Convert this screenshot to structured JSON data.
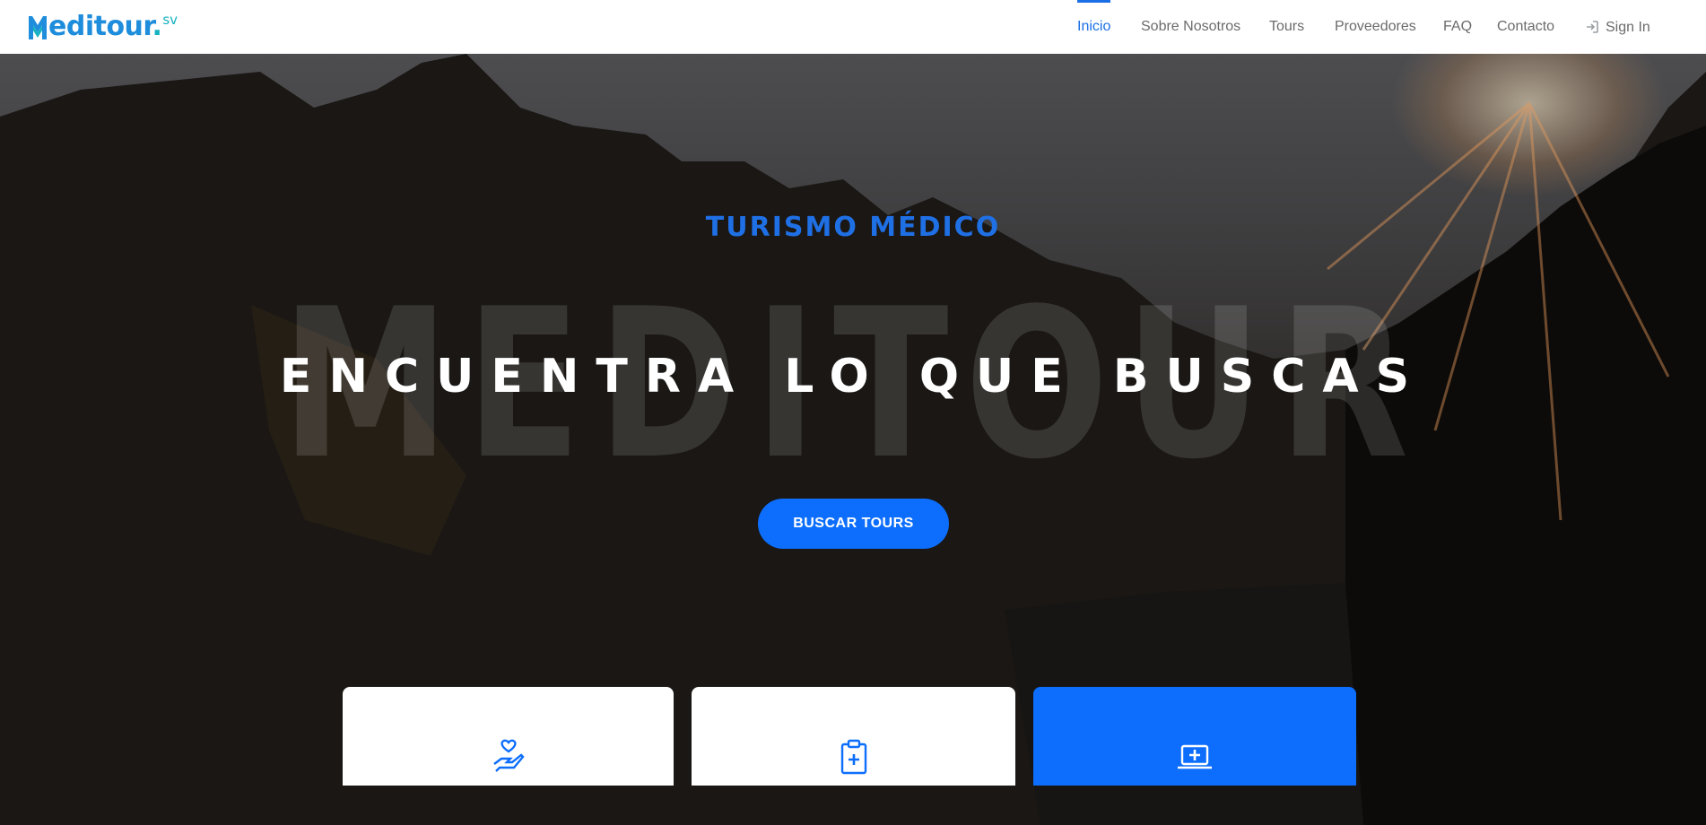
{
  "brand": {
    "name_part1": "M",
    "name_part2": "editour",
    "dot": ".",
    "suffix": "sv"
  },
  "nav": {
    "items": [
      {
        "label": "Inicio",
        "active": true
      },
      {
        "label": "Sobre Nosotros",
        "active": false
      },
      {
        "label": "Tours",
        "active": false
      },
      {
        "label": "Proveedores",
        "active": false
      },
      {
        "label": "FAQ",
        "active": false
      },
      {
        "label": "Contacto",
        "active": false
      }
    ],
    "signin_label": "Sign In",
    "signin_icon": "sign-in-icon"
  },
  "hero": {
    "eyebrow": "TURISMO MÉDICO",
    "watermark": "MEDITOUR",
    "headline": "ENCUENTRA LO QUE BUSCAS",
    "cta_label": "BUSCAR TOURS"
  },
  "features": [
    {
      "icon": "hand-heart-icon",
      "style": "white"
    },
    {
      "icon": "clipboard-medical-icon",
      "style": "white"
    },
    {
      "icon": "laptop-medical-icon",
      "style": "blue"
    }
  ],
  "colors": {
    "accent": "#0d6efd",
    "nav_active": "#1b6fe4",
    "logo_blue": "#1e8ddc",
    "logo_teal": "#17b3c1"
  }
}
